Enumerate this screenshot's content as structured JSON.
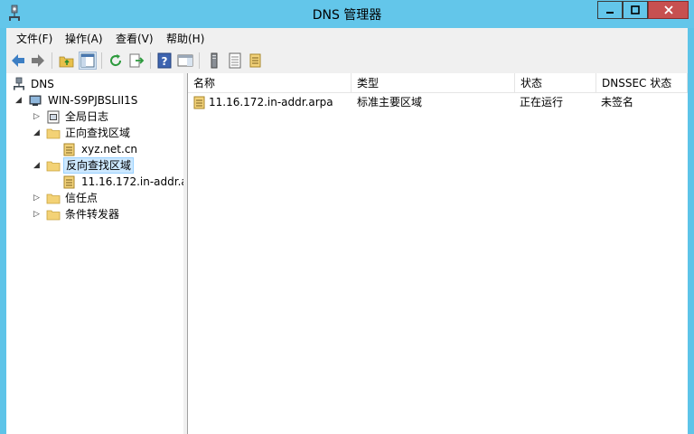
{
  "window": {
    "title": "DNS 管理器",
    "icon": "dns-server-icon"
  },
  "menu": {
    "items": [
      {
        "label": "文件(F)"
      },
      {
        "label": "操作(A)"
      },
      {
        "label": "查看(V)"
      },
      {
        "label": "帮助(H)"
      }
    ]
  },
  "toolbar": {
    "buttons": [
      "back-arrow-icon",
      "forward-arrow-icon",
      "up-folder-icon",
      "show-hide-console-tree-icon",
      "refresh-icon",
      "export-list-icon",
      "help-icon",
      "action-pane-icon",
      "server-icon",
      "list-icon",
      "zone-icon"
    ]
  },
  "tree": {
    "root": "DNS",
    "server": "WIN-S9PJBSLII1S",
    "global_logs": "全局日志",
    "forward_zones": "正向查找区域",
    "forward_zone_item": "xyz.net.cn",
    "reverse_zones": "反向查找区域",
    "reverse_zone_item": "11.16.172.in-addr.a",
    "trust_points": "信任点",
    "conditional_forwarders": "条件转发器"
  },
  "list": {
    "columns": [
      "名称",
      "类型",
      "状态",
      "DNSSEC 状态"
    ],
    "rows": [
      {
        "name": "11.16.172.in-addr.arpa",
        "type": "标准主要区域",
        "status": "正在运行",
        "dnssec": "未签名"
      }
    ]
  }
}
